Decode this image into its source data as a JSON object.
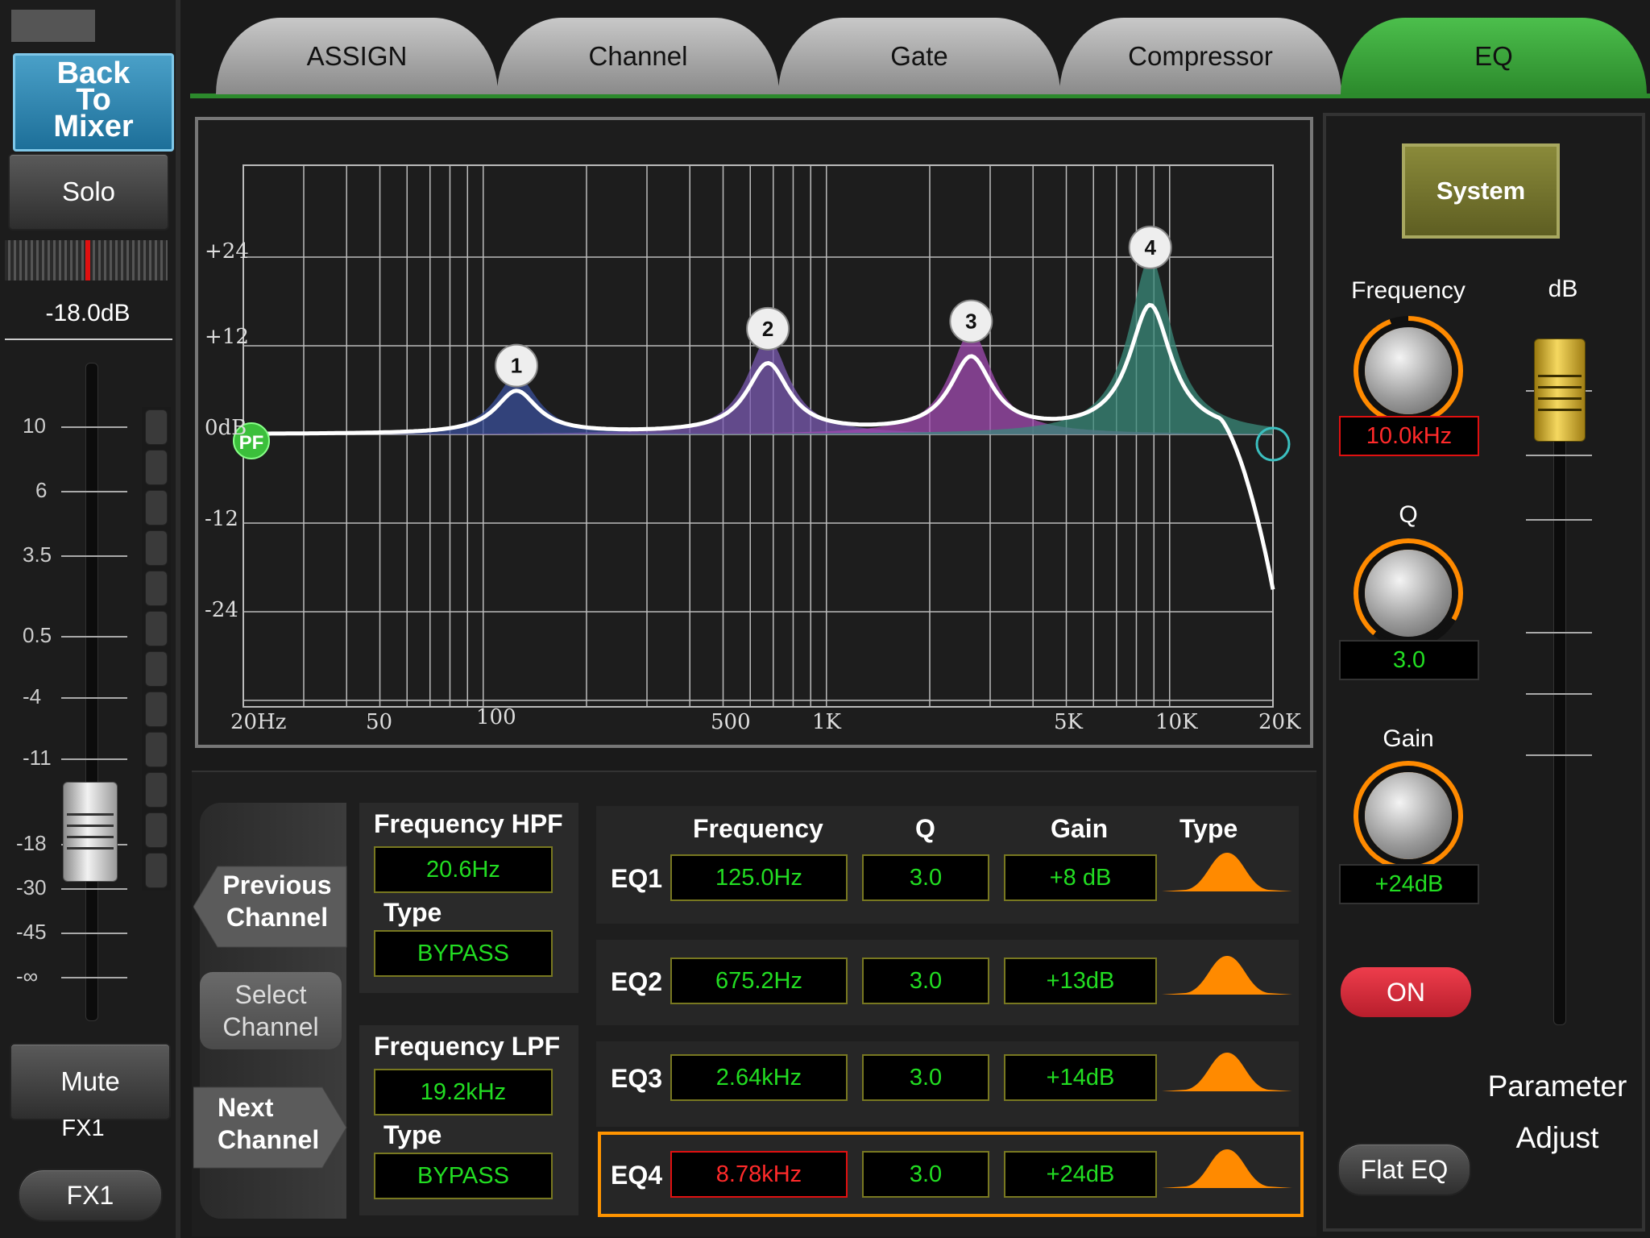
{
  "left": {
    "back_label_1": "Back",
    "back_label_2": "To",
    "back_label_3": "Mixer",
    "solo": "Solo",
    "level": "-18.0dB",
    "scale": [
      "10",
      "6",
      "3.5",
      "0.5",
      "-4",
      "-11",
      "-18",
      "-30",
      "-45",
      "-∞"
    ],
    "mute": "Mute",
    "channel_name": "FX1",
    "fx_button": "FX1"
  },
  "tabs": [
    "ASSIGN",
    "Channel",
    "Gate",
    "Compressor",
    "EQ"
  ],
  "active_tab": "EQ",
  "graph": {
    "y_labels": [
      "+24",
      "+12",
      "0dB",
      "-12",
      "-24"
    ],
    "x_labels": [
      "20Hz",
      "50",
      "100",
      "500",
      "1K",
      "5K",
      "10K",
      "20K"
    ],
    "hpf_marker": "PF",
    "bands": [
      {
        "num": "1",
        "freq_hz": 125,
        "gain_db": 8,
        "color": "#3a4f9a"
      },
      {
        "num": "2",
        "freq_hz": 675.2,
        "gain_db": 13,
        "color": "#7a5ab0"
      },
      {
        "num": "3",
        "freq_hz": 2640,
        "gain_db": 14,
        "color": "#a04bb0"
      },
      {
        "num": "4",
        "freq_hz": 8780,
        "gain_db": 24,
        "color": "#3a8a7a"
      }
    ]
  },
  "nav": {
    "prev_1": "Previous",
    "prev_2": "Channel",
    "select_1": "Select",
    "select_2": "Channel",
    "next_1": "Next",
    "next_2": "Channel"
  },
  "filters": {
    "hpf_title": "Frequency HPF",
    "hpf_value": "20.6Hz",
    "hpf_type_label": "Type",
    "hpf_type": "BYPASS",
    "lpf_title": "Frequency LPF",
    "lpf_value": "19.2kHz",
    "lpf_type_label": "Type",
    "lpf_type": "BYPASS"
  },
  "eq_table": {
    "headers": [
      "Frequency",
      "Q",
      "Gain",
      "Type"
    ],
    "rows": [
      {
        "label": "EQ1",
        "freq": "125.0Hz",
        "q": "3.0",
        "gain": "+8 dB"
      },
      {
        "label": "EQ2",
        "freq": "675.2Hz",
        "q": "3.0",
        "gain": "+13dB"
      },
      {
        "label": "EQ3",
        "freq": "2.64kHz",
        "q": "3.0",
        "gain": "+14dB"
      },
      {
        "label": "EQ4",
        "freq": "8.78kHz",
        "q": "3.0",
        "gain": "+24dB"
      }
    ],
    "selected": "EQ4"
  },
  "right": {
    "system": "System",
    "frequency_label": "Frequency",
    "frequency_value": "10.0kHz",
    "q_label": "Q",
    "q_value": "3.0",
    "gain_label": "Gain",
    "gain_value": "+24dB",
    "db_label": "dB",
    "on": "ON",
    "flat_eq": "Flat EQ",
    "param_1": "Parameter",
    "param_2": "Adjust"
  },
  "colors": {
    "accent_green": "#22dd22",
    "alert_red": "#ff2a2a",
    "orange": "#ff8a00",
    "tab_active": "#3aa63a"
  }
}
